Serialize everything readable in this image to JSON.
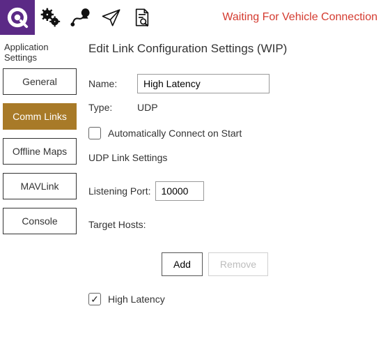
{
  "status_text": "Waiting For Vehicle Connection",
  "sidebar": {
    "title": "Application Settings",
    "items": [
      "General",
      "Comm Links",
      "Offline Maps",
      "MAVLink",
      "Console"
    ],
    "active_index": 1
  },
  "page": {
    "title": "Edit Link Configuration Settings (WIP)",
    "name_label": "Name:",
    "name_value": "High Latency",
    "type_label": "Type:",
    "type_value": "UDP",
    "auto_connect_label": "Automatically Connect on Start",
    "auto_connect_checked": false,
    "udp_section_label": "UDP Link Settings",
    "listening_port_label": "Listening Port:",
    "listening_port_value": "10000",
    "target_hosts_label": "Target Hosts:",
    "add_button": "Add",
    "remove_button": "Remove",
    "high_latency_label": "High Latency",
    "high_latency_checked": true
  }
}
